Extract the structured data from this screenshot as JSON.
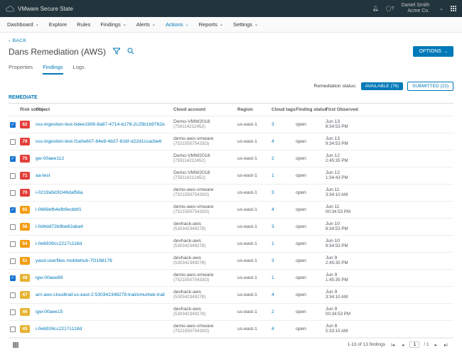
{
  "brand": "VMware Secure State",
  "user": {
    "name": "Daniel Smith",
    "company": "Acme Co."
  },
  "nav": {
    "items": [
      "Dashboard",
      "Explore",
      "Rules",
      "Findings",
      "Alerts",
      "Actions",
      "Reports",
      "Settings"
    ],
    "active": "Actions"
  },
  "back": "BACK",
  "title": "Dans Remediation (AWS)",
  "options": "OPTIONS",
  "tabs": {
    "items": [
      "Properties",
      "Findings",
      "Logs"
    ],
    "active": "Findings"
  },
  "remediationStatusLabel": "Remediation status:",
  "pills": {
    "available": "AVAILABLE (76)",
    "submitted": "SUBMITTED (22)"
  },
  "remediateAction": "REMEDIATE",
  "columns": [
    "Risk score",
    "Object",
    "Cloud account",
    "Region",
    "Cloud tags",
    "Finding status",
    "First Observed"
  ],
  "riskColors": {
    "red": "#e33e3a",
    "orange": "#f39c12",
    "yellow": "#e6b333"
  },
  "rows": [
    {
      "checked": true,
      "risk": 82,
      "color": "red",
      "object": "vss-ingestion-test-bdee1908-8a87-4714-b178-2c25b1b9762e",
      "acct": "Demo-VMW2018",
      "acctId": "(759114212452)",
      "region": "us-east-1",
      "tags": "3",
      "status": "open",
      "date": "Jun 13",
      "time": "8:34:53 PM"
    },
    {
      "checked": false,
      "risk": 79,
      "color": "red",
      "object": "vss-ingestion-test-f1a0e607-84e9-4b37-816f-d22d1ccacbe6",
      "acct": "demo-aws-vmware",
      "acctId": "(752155075433O)",
      "region": "us-east-1",
      "tags": "4",
      "status": "open",
      "date": "Jun 13",
      "time": "9:34:53 PM"
    },
    {
      "checked": true,
      "risk": 75,
      "color": "red",
      "object": "gw-00aee112",
      "acct": "Demo-VMW2018",
      "acctId": "(759114212452)",
      "region": "us-east-1",
      "tags": "2",
      "status": "open",
      "date": "Jun 12",
      "time": "2:45:35 PM"
    },
    {
      "checked": false,
      "risk": 71,
      "color": "red",
      "object": "aa-test",
      "acct": "Demo-VMW2018",
      "acctId": "(759114212452)",
      "region": "us-east-1",
      "tags": "1",
      "status": "open",
      "date": "Jun 12",
      "time": "1:34:43 PM"
    },
    {
      "checked": false,
      "risk": 70,
      "color": "red",
      "object": "i-0219a5d3O46daf56a",
      "acct": "demo-aws-vmware",
      "acctId": "(752155075433O)",
      "region": "us-east-1",
      "tags": "3",
      "status": "open",
      "date": "Jun 11",
      "time": "3:34:10 AM"
    },
    {
      "checked": true,
      "risk": 65,
      "color": "orange",
      "object": "i-0669efb4efb9ecbbf1",
      "acct": "demo-aws-vmware",
      "acctId": "(752155075433O)",
      "region": "us-east-1",
      "tags": "4",
      "status": "open",
      "date": "Jun 11",
      "time": "00:34:53 PM"
    },
    {
      "checked": false,
      "risk": 58,
      "color": "orange",
      "object": "i-0d4dd72b9be62aba4",
      "acct": "devhack-aws",
      "acctId": "(530342349278)",
      "region": "us-east-1",
      "tags": "3",
      "status": "open",
      "date": "Jun 10",
      "time": "8:34:53 PM"
    },
    {
      "checked": false,
      "risk": 54,
      "color": "orange",
      "object": "i-0e6926cc2217c118d",
      "acct": "devhack-aws",
      "acctId": "(530342349278)",
      "region": "us-east-1",
      "tags": "1",
      "status": "open",
      "date": "Jun 10",
      "time": "9:34:53 PM"
    },
    {
      "checked": false,
      "risk": 51,
      "color": "orange",
      "object": "yasd-userfiles-mobilehub-7O168176",
      "acct": "devhack-aws",
      "acctId": "(530342349278)",
      "region": "us-east-1",
      "tags": "3",
      "status": "open",
      "date": "Jun 9",
      "time": "2:45:35 PM"
    },
    {
      "checked": true,
      "risk": 48,
      "color": "yellow",
      "object": "igw-00aee89",
      "acct": "demo-aws-vmware",
      "acctId": "(752155075433O)",
      "region": "us-east-1",
      "tags": "1",
      "status": "open",
      "date": "Jun 9",
      "time": "1:45:35 PM"
    },
    {
      "checked": false,
      "risk": 47,
      "color": "yellow",
      "object": "arn:aws:cloudtrail:us-east-2:530342348278:trail/omurbek-trail",
      "acct": "devhack-aws",
      "acctId": "(530342349278)",
      "region": "us-east-1",
      "tags": "4",
      "status": "open",
      "date": "Jun 9",
      "time": "3:34:10 AM"
    },
    {
      "checked": false,
      "risk": 46,
      "color": "yellow",
      "object": "igw-00aee15",
      "acct": "devhack-aws",
      "acctId": "(530342349278)",
      "region": "us-east-1",
      "tags": "2",
      "status": "open",
      "date": "Jun 9",
      "time": "00:34:53 PM"
    },
    {
      "checked": false,
      "risk": 45,
      "color": "yellow",
      "object": "i-0e6926cc2217c118d",
      "acct": "demo-aws-vmware",
      "acctId": "(752155075433O)",
      "region": "us-east-1",
      "tags": "4",
      "status": "open",
      "date": "Jun 8",
      "time": "5:33:15 AM"
    }
  ],
  "footer": {
    "summary": "1-13 of 13 findings",
    "page": "1",
    "totalPages": "/ 1"
  }
}
